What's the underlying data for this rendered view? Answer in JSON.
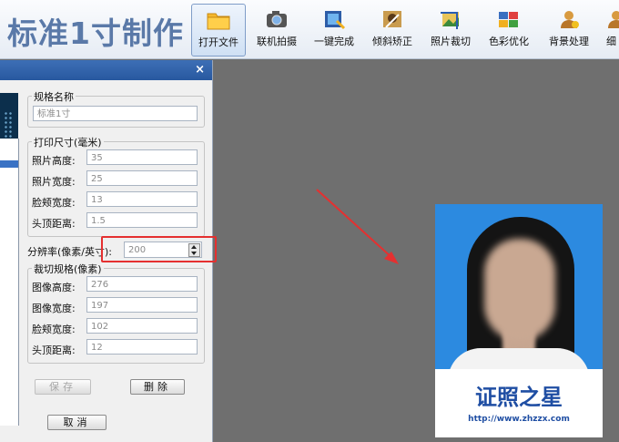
{
  "app": {
    "title": "标准1寸制作"
  },
  "toolbar": {
    "buttons": [
      {
        "label": "打开文件",
        "icon": "folder-icon"
      },
      {
        "label": "联机拍摄",
        "icon": "camera-icon"
      },
      {
        "label": "一键完成",
        "icon": "film-magic-icon"
      },
      {
        "label": "倾斜矫正",
        "icon": "tilt-correct-icon"
      },
      {
        "label": "照片裁切",
        "icon": "crop-icon"
      },
      {
        "label": "色彩优化",
        "icon": "color-optimize-icon"
      },
      {
        "label": "背景处理",
        "icon": "background-process-icon"
      },
      {
        "label": "细",
        "icon": "person-icon"
      }
    ]
  },
  "dialog": {
    "close_glyph": "×",
    "spec_name": {
      "legend": "规格名称",
      "value": "标准1寸"
    },
    "print_size": {
      "legend": "打印尺寸(毫米)",
      "rows": [
        {
          "label": "照片高度:",
          "value": "35"
        },
        {
          "label": "照片宽度:",
          "value": "25"
        },
        {
          "label": "脸颊宽度:",
          "value": "13"
        },
        {
          "label": "头顶距离:",
          "value": "1.5"
        }
      ]
    },
    "resolution": {
      "label": "分辨率(像素/英寸):",
      "value": "200"
    },
    "crop_spec": {
      "legend": "裁切规格(像素)",
      "rows": [
        {
          "label": "图像高度:",
          "value": "276"
        },
        {
          "label": "图像宽度:",
          "value": "197"
        },
        {
          "label": "脸颊宽度:",
          "value": "102"
        },
        {
          "label": "头顶距离:",
          "value": "12"
        }
      ]
    },
    "save_label": "保存",
    "delete_label": "删除",
    "cancel_label": "取消"
  },
  "preview": {
    "watermark_title": "证照之星",
    "watermark_url": "http://www.zhzzx.com"
  },
  "colors": {
    "accent": "#e53030",
    "title": "#5a79a8",
    "photo_bg": "#2c8ae0",
    "watermark": "#1f4ea3"
  }
}
